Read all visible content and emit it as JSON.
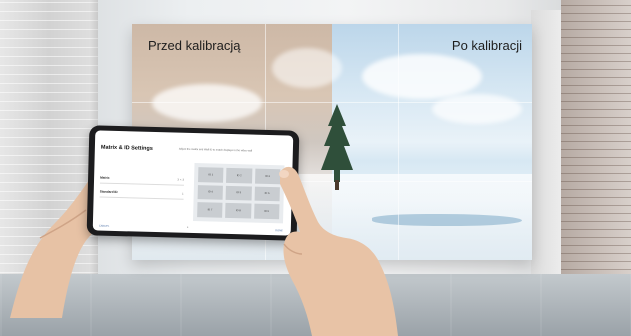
{
  "wall": {
    "label_before": "Przed kalibracją",
    "label_after": "Po kalibracji"
  },
  "phone_app": {
    "title": "Matrix & ID Settings",
    "description": "Adjust the matrix and Wall ID to match displays in the video wall",
    "status": "",
    "fields": [
      {
        "label": "Matrix",
        "value": "3 × 3"
      },
      {
        "label": "Standard ID",
        "value": "1"
      }
    ],
    "matrix_cells": [
      "ID 1",
      "ID 2",
      "ID 3",
      "ID 4",
      "ID 5",
      "ID 6",
      "ID 7",
      "ID 8",
      "ID 9"
    ],
    "cancel_label": "CANCEL",
    "done_label": "DONE"
  },
  "colors": {
    "before_tone": "#cdb8a6",
    "after_tone": "#bcd6ea",
    "phone_body": "#1c1c1e"
  }
}
